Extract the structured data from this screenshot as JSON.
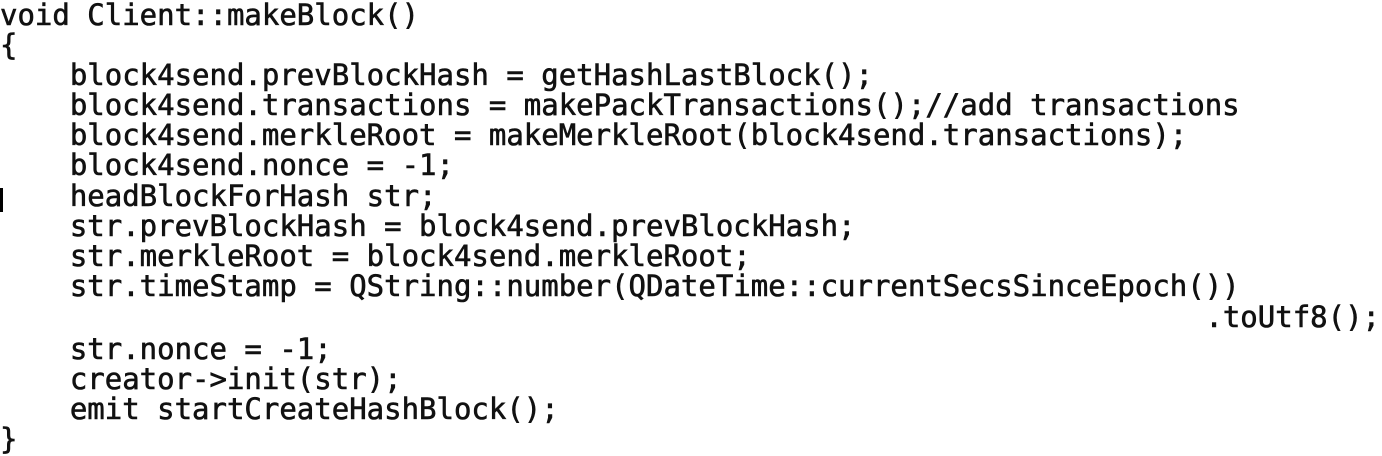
{
  "code": {
    "lines": [
      "void Client::makeBlock()",
      "{",
      "    block4send.prevBlockHash = getHashLastBlock();",
      "    block4send.transactions = makePackTransactions();//add transactions",
      "    block4send.merkleRoot = makeMerkleRoot(block4send.transactions);",
      "    block4send.nonce = -1;",
      "    headBlockForHash str;",
      "    str.prevBlockHash = block4send.prevBlockHash;",
      "    str.merkleRoot = block4send.merkleRoot;",
      "    str.timeStamp = QString::number(QDateTime::currentSecsSinceEpoch())",
      ".toUtf8();",
      "    str.nonce = -1;",
      "    creator->init(str);",
      "    emit startCreateHashBlock();",
      "}"
    ]
  }
}
